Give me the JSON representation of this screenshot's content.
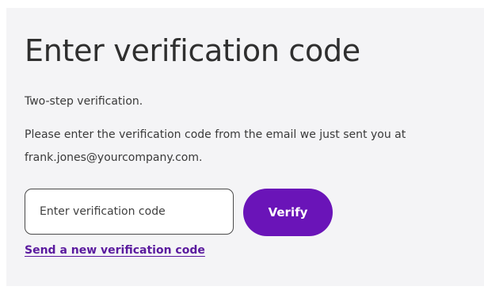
{
  "verification": {
    "title": "Enter verification code",
    "subtitle": "Two-step verification.",
    "description": "Please enter the verification code from the email we just sent you at frank.jones@yourcompany.com.",
    "code_input": {
      "placeholder": "Enter verification code",
      "value": ""
    },
    "verify_label": "Verify",
    "resend_label": "Send a new verification code"
  },
  "colors": {
    "card_background": "#f4f4f6",
    "accent": "#6a14b8",
    "link": "#5a1a9e",
    "text": "#2f2f2f"
  }
}
